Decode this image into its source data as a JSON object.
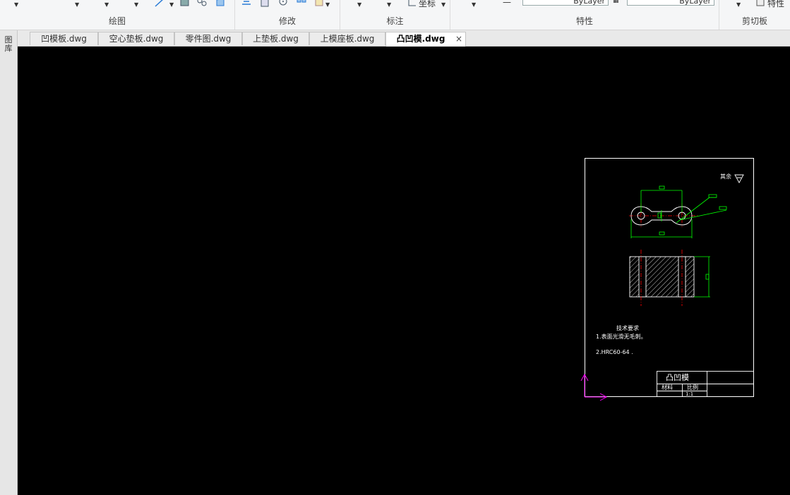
{
  "ribbon": {
    "sections": {
      "draw": "绘图",
      "modify": "修改",
      "annotate": "标注",
      "properties": "特性",
      "clipboard": "剪切板"
    },
    "coord_label": "坐标",
    "bylayer_1": "ByLayer",
    "bylayer_2": "ByLayer",
    "properties_btn": "特性"
  },
  "tabs": [
    {
      "label": "凹模板.dwg"
    },
    {
      "label": "空心垫板.dwg"
    },
    {
      "label": "零件图.dwg"
    },
    {
      "label": "上垫板.dwg"
    },
    {
      "label": "上模座板.dwg"
    },
    {
      "label": "凸凹模.dwg",
      "active": true
    }
  ],
  "tab_close": "×",
  "left_panel": {
    "label": "图库"
  },
  "drawing": {
    "roughness_note": "其余",
    "tech_title": "技术要求",
    "tech_line1": "1.表面光滑无毛刺。",
    "tech_line2": "2.HRC60-64 .",
    "title_block": {
      "name": "凸凹模",
      "material_label": "材料",
      "scale_label": "比例",
      "scale_value": "1:1"
    }
  },
  "colors": {
    "canvas_bg": "#000000",
    "dim_green": "#00ff00",
    "center_red": "#ff0000",
    "ucs_magenta": "#ff00ff"
  }
}
